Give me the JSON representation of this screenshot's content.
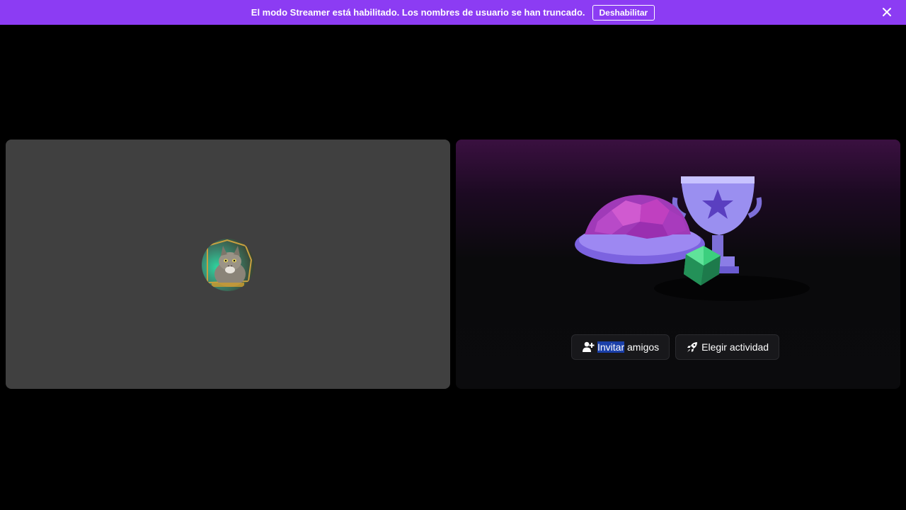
{
  "banner": {
    "message": "El modo Streamer está habilitado. Los nombres de usuario se han truncado.",
    "button_label": "Deshabilitar",
    "close_icon": "close-icon",
    "color": "#8c3cf3"
  },
  "left_tile": {
    "background": "#404040",
    "avatar_icon": "cat-avatar"
  },
  "right_tile": {
    "illustration": "trophy-shell-dice-illustration",
    "buttons": {
      "invite_highlight": "Invitar",
      "invite_rest": " amigos",
      "invite_icon": "person-add-icon",
      "activity_label": "Elegir actividad",
      "activity_icon": "rocket-icon"
    }
  }
}
